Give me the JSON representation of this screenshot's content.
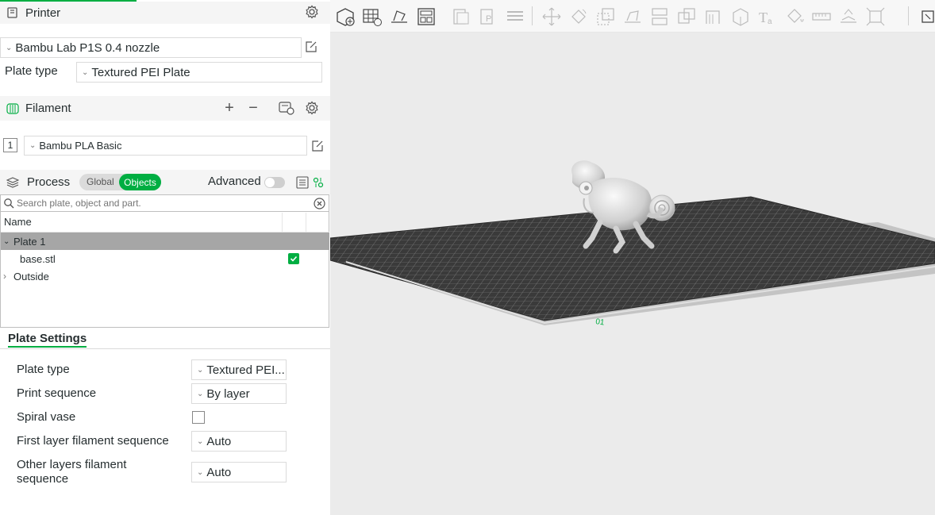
{
  "printer": {
    "title": "Printer",
    "preset": "Bambu Lab P1S 0.4 nozzle",
    "plate_type_label": "Plate type",
    "plate_type_value": "Textured PEI Plate"
  },
  "filament": {
    "title": "Filament",
    "slot_number": "1",
    "preset": "Bambu PLA Basic"
  },
  "process": {
    "title": "Process",
    "tab_global": "Global",
    "tab_objects": "Objects",
    "advanced_label": "Advanced"
  },
  "search": {
    "placeholder": "Search plate, object and part."
  },
  "tree": {
    "header_name": "Name",
    "plate": "Plate 1",
    "object": "base.stl",
    "outside": "Outside"
  },
  "plate_settings": {
    "tab_label": "Plate Settings",
    "rows": [
      {
        "label": "Plate type",
        "value": "Textured PEI..."
      },
      {
        "label": "Print sequence",
        "value": "By layer"
      },
      {
        "label": "Spiral vase",
        "value": ""
      },
      {
        "label": "First layer filament sequence",
        "value": "Auto"
      },
      {
        "label": "Other layers filament\nsequence",
        "value": "Auto"
      }
    ]
  },
  "colors": {
    "accent": "#00ae42",
    "section_bg": "#f5f5f5",
    "selected_row": "#a6a6a6",
    "viewport_bg": "#ebebeb",
    "bed": "#3a3a3a"
  }
}
